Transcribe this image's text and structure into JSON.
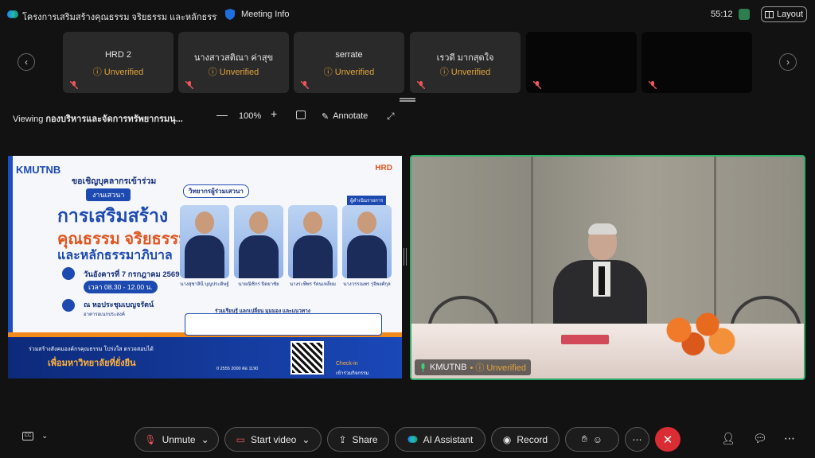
{
  "titlebar": {
    "meeting_title": "โครงการเสริมสร้างคุณธรรม จริยธรรม และหลักธรรมาภิ...",
    "meeting_info": "Meeting Info",
    "timer": "55:12",
    "layout_label": "Layout"
  },
  "participants": [
    {
      "name": "HRD 2",
      "status": "Unverified"
    },
    {
      "name": "นางสาวสติณา ค่าสุข",
      "status": "Unverified"
    },
    {
      "name": "serrate",
      "status": "Unverified"
    },
    {
      "name": "เรวดี มากสุดใจ",
      "status": "Unverified"
    },
    {
      "name": "",
      "status": ""
    },
    {
      "name": "",
      "status": ""
    }
  ],
  "viewbar": {
    "viewing_prefix": "Viewing",
    "viewing_name": "กองบริหารและจัดการทรัพยากรมนุ...",
    "zoom_minus": "—",
    "zoom": "100%",
    "zoom_plus": "+",
    "annotate": "Annotate"
  },
  "poster": {
    "logo": "KMUTNB",
    "hrd": "HRD",
    "invite": "ขอเชิญบุคลากรเข้าร่วม",
    "event_tag": "งานเสวนา",
    "headline1": "การเสริมสร้าง",
    "headline2": "คุณธรรม จริยธรรม",
    "headline3": "และหลักธรรมาภิบาล",
    "date": "วันอังคารที่ 7 กรกฎาคม 2569",
    "time": "เวลา 08.30 - 12.00 น.",
    "venue": "ณ หอประชุมเบญจรัตน์",
    "venue_detail": "อาคารอเนกประสงค์",
    "speakers_tag": "วิทยากรผู้ร่วมเสวนา",
    "moderator_tag": "ผู้ดำเนินรายการ",
    "speakers": [
      "นางสุชาลินี บุญประดิษฐ์",
      "นายณิชิกร ปิตยาชัย",
      "นางระพีพร รัตนเหลี่ยม",
      "นางวรรณพร รุจิพงศ์กุล"
    ],
    "join_text": "ร่วมเรียนรู้ แลกเปลี่ยน มุมมอง และแนวทาง",
    "quote_line": "ร่วมสร้างสังคมองค์กรคุณธรรม โปร่งใส ตรวจสอบได้",
    "quote_main": "เพื่อมหาวิทยาลัยที่ยั่งยืน",
    "phone": "0 2555 2000 ต่อ 1190",
    "checkin": "Check-in",
    "checkin_sub": "เข้าร่วมกิจกรรม"
  },
  "camera": {
    "label": "KMUTNB",
    "status": "Unverified"
  },
  "toolbar": {
    "mute": "Unmute",
    "start_video": "Start video",
    "share": "Share",
    "ai_assistant": "AI Assistant",
    "record": "Record"
  },
  "colors": {
    "accent_green": "#2fae6a",
    "end_red": "#d92c33",
    "unverified": "#e2a43c"
  }
}
